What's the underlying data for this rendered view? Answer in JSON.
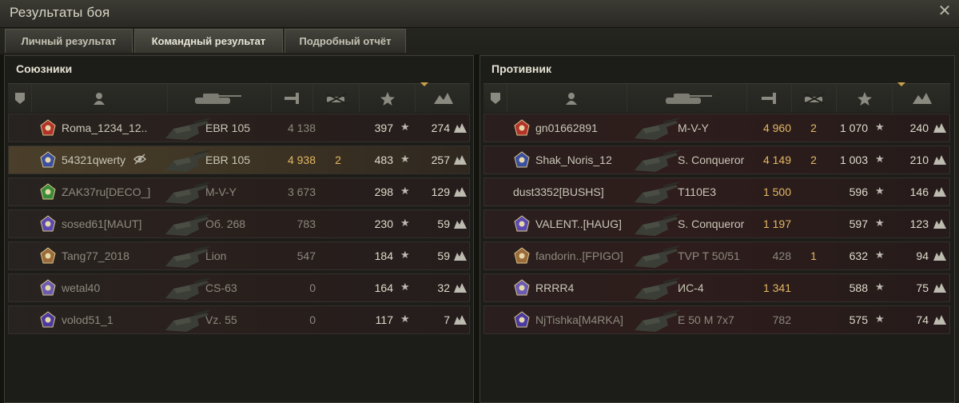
{
  "window": {
    "title": "Результаты боя",
    "close_icon": "close-icon"
  },
  "tabs": [
    {
      "label": "Личный результат",
      "active": false
    },
    {
      "label": "Командный результат",
      "active": true
    },
    {
      "label": "Подробный отчёт",
      "active": false
    }
  ],
  "allies": {
    "title": "Союзники",
    "columns": [
      "rank-icon",
      "player-icon",
      "tank-icon",
      "damage-icon",
      "kills-icon",
      "xp-star-icon",
      "score-icon"
    ],
    "rows": [
      {
        "name": "Roma_1234_12..",
        "vehicle": "EBR 105",
        "damage": "4 138",
        "damage_hi": false,
        "kills": "",
        "xp": "397",
        "score": "274",
        "selected": false,
        "dim": false,
        "eye": false
      },
      {
        "name": "54321qwerty",
        "vehicle": "EBR 105",
        "damage": "4 938",
        "damage_hi": true,
        "kills": "2",
        "xp": "483",
        "score": "257",
        "selected": true,
        "dim": false,
        "eye": true
      },
      {
        "name": "ZAK37ru[DECO_]",
        "vehicle": "M-V-Y",
        "damage": "3 673",
        "damage_hi": false,
        "kills": "",
        "xp": "298",
        "score": "129",
        "selected": false,
        "dim": true,
        "eye": false
      },
      {
        "name": "sosed61[MAUT]",
        "vehicle": "Об. 268",
        "damage": "783",
        "damage_hi": false,
        "kills": "",
        "xp": "230",
        "score": "59",
        "selected": false,
        "dim": true,
        "eye": false
      },
      {
        "name": "Tang77_2018",
        "vehicle": "Lion",
        "damage": "547",
        "damage_hi": false,
        "kills": "",
        "xp": "184",
        "score": "59",
        "selected": false,
        "dim": true,
        "eye": false
      },
      {
        "name": "wetal40",
        "vehicle": "CS-63",
        "damage": "0",
        "damage_hi": false,
        "kills": "",
        "xp": "164",
        "score": "32",
        "selected": false,
        "dim": true,
        "eye": false
      },
      {
        "name": "volod51_1",
        "vehicle": "Vz. 55",
        "damage": "0",
        "damage_hi": false,
        "kills": "",
        "xp": "117",
        "score": "7",
        "selected": false,
        "dim": true,
        "eye": false
      }
    ]
  },
  "enemies": {
    "title": "Противник",
    "rows": [
      {
        "name": "gn01662891",
        "vehicle": "M-V-Y",
        "damage": "4 960",
        "damage_hi": true,
        "kills": "2",
        "xp": "1 070",
        "score": "240",
        "dim": false
      },
      {
        "name": "Shak_Noris_12",
        "vehicle": "S. Conqueror",
        "damage": "4 149",
        "damage_hi": true,
        "kills": "2",
        "xp": "1 003",
        "score": "210",
        "dim": false
      },
      {
        "name": "dust3352[BUSHS]",
        "vehicle": "T110E3",
        "damage": "1 500",
        "damage_hi": true,
        "kills": "",
        "xp": "596",
        "score": "146",
        "dim": false
      },
      {
        "name": "VALENT..[HAUG]",
        "vehicle": "S. Conqueror",
        "damage": "1 197",
        "damage_hi": true,
        "kills": "",
        "xp": "597",
        "score": "123",
        "dim": false
      },
      {
        "name": "fandorin..[FPIGO]",
        "vehicle": "TVP T 50/51",
        "damage": "428",
        "damage_hi": false,
        "kills": "1",
        "xp": "632",
        "score": "94",
        "dim": true
      },
      {
        "name": "RRRR4",
        "vehicle": "ИС-4",
        "damage": "1 341",
        "damage_hi": true,
        "kills": "",
        "xp": "588",
        "score": "75",
        "dim": false
      },
      {
        "name": "NjTishka[M4RKA]",
        "vehicle": "E 50 M 7x7",
        "damage": "782",
        "damage_hi": false,
        "kills": "",
        "xp": "575",
        "score": "74",
        "dim": true
      }
    ]
  },
  "colors": {
    "gold": "#e3b763",
    "muted": "#8a877b",
    "text": "#c9c6b7"
  },
  "symbols": {
    "star": "★"
  }
}
